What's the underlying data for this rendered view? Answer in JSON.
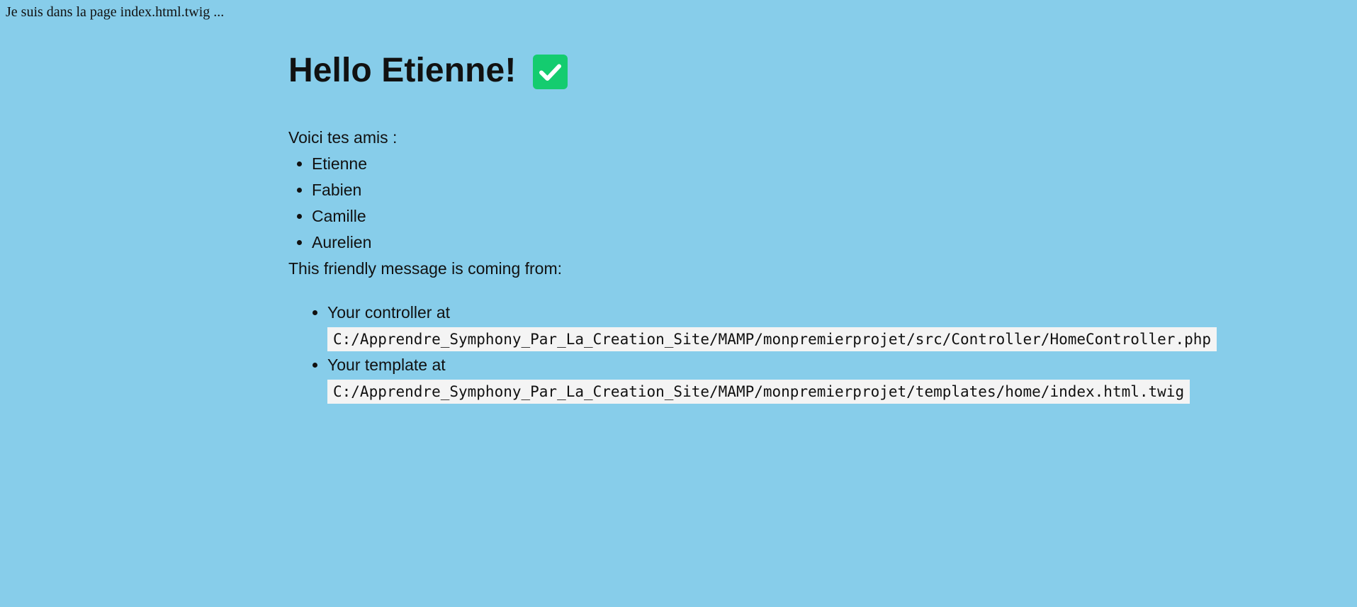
{
  "top_note": "Je suis dans la page index.html.twig ...",
  "heading": "Hello Etienne!",
  "icons": {
    "check": "check-mark-button-icon"
  },
  "colors": {
    "background": "#87cdea",
    "check_bg": "#14cc6f",
    "code_bg": "#f4f4f4"
  },
  "friends_intro": "Voici tes amis :",
  "friends": [
    "Etienne",
    "Fabien",
    "Camille",
    "Aurelien"
  ],
  "message": "This friendly message is coming from:",
  "sources": [
    {
      "label": "Your controller at",
      "path": "C:/Apprendre_Symphony_Par_La_Creation_Site/MAMP/monpremierprojet/src/Controller/HomeController.php"
    },
    {
      "label": "Your template at",
      "path": "C:/Apprendre_Symphony_Par_La_Creation_Site/MAMP/monpremierprojet/templates/home/index.html.twig"
    }
  ]
}
